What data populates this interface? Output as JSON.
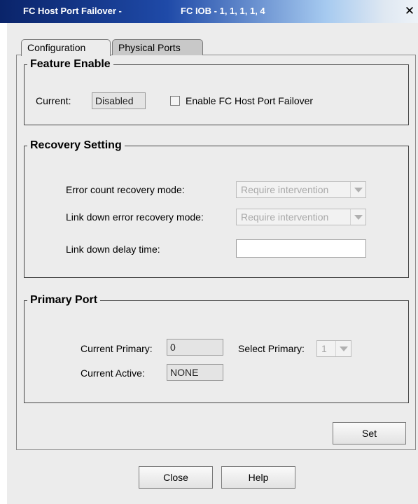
{
  "window": {
    "title_left": "FC Host Port Failover -",
    "title_right": "FC IOB - 1, 1, 1, 1, 4",
    "close_glyph": "✕"
  },
  "tabs": [
    {
      "label": "Configuration",
      "active": true
    },
    {
      "label": "Physical Ports",
      "active": false
    }
  ],
  "feature_enable": {
    "legend": "Feature Enable",
    "current_label": "Current:",
    "current_value": "Disabled",
    "checkbox_label": "Enable FC Host Port Failover",
    "checkbox_checked": false
  },
  "recovery_setting": {
    "legend": "Recovery Setting",
    "error_count_label": "Error count recovery mode:",
    "error_count_value": "Require intervention",
    "link_down_label": "Link down error recovery mode:",
    "link_down_value": "Require intervention",
    "delay_label": "Link down delay time:",
    "delay_value": ""
  },
  "primary_port": {
    "legend": "Primary Port",
    "current_primary_label": "Current Primary:",
    "current_primary_value": "0",
    "select_primary_label": "Select Primary:",
    "select_primary_value": "1",
    "current_active_label": "Current Active:",
    "current_active_value": "NONE"
  },
  "buttons": {
    "set": "Set",
    "close": "Close",
    "help": "Help"
  },
  "colors": {
    "title_bar_start": "#0a246a",
    "dialog_bg": "#ececec"
  }
}
